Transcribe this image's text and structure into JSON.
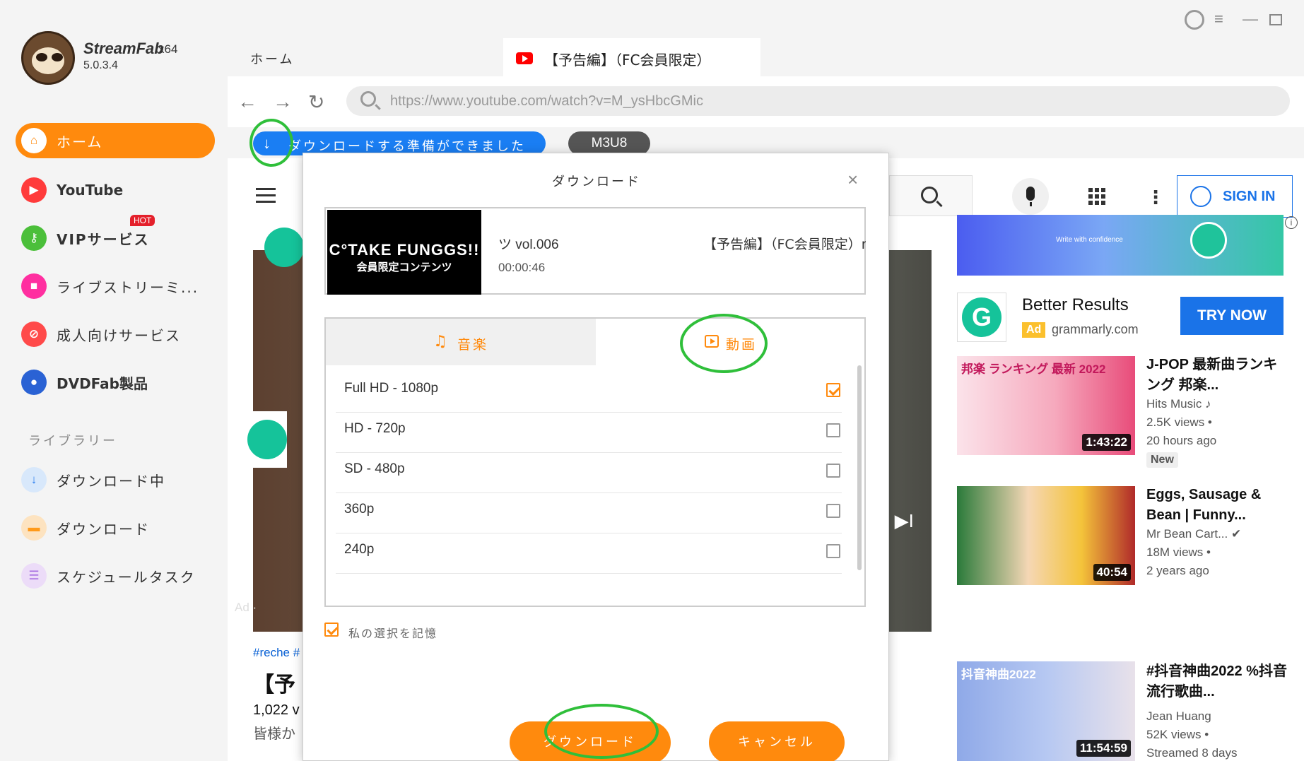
{
  "app": {
    "name": "StreamFab",
    "arch": "x64",
    "version": "5.0.3.4"
  },
  "sidebar": {
    "items": [
      {
        "label": "ホーム",
        "icon": "home-icon",
        "color": "#ff8a0d",
        "active": true
      },
      {
        "label": "YouTube",
        "icon": "youtube-icon",
        "color": "#ff3b3b",
        "active": false
      },
      {
        "label": "VIPサービス",
        "icon": "key-icon",
        "color": "#4bbf3a",
        "active": false,
        "badge": "HOT"
      },
      {
        "label": "ライブストリーミ...",
        "icon": "camera-icon",
        "color": "#ff2fa0",
        "active": false
      },
      {
        "label": "成人向けサービス",
        "icon": "adult-icon",
        "color": "#ff4a4a",
        "active": false
      },
      {
        "label": "DVDFab製品",
        "icon": "dvdfab-icon",
        "color": "#2a62d4",
        "active": false
      }
    ],
    "library_title": "ライブラリー",
    "library_items": [
      {
        "label": "ダウンロード中",
        "icon": "download-icon",
        "color": "#2a7ef0"
      },
      {
        "label": "ダウンロード",
        "icon": "folder-icon",
        "color": "#ff9a1a"
      },
      {
        "label": "スケジュールタスク",
        "icon": "calendar-icon",
        "color": "#a56be0"
      }
    ]
  },
  "tabs": {
    "home": "ホーム",
    "active": "【予告編】（FC会員限定）"
  },
  "browser": {
    "url": "https://www.youtube.com/watch?v=M_ysHbcGMic",
    "ready_text": "ダウンロードする準備ができました",
    "m3u8": "M3U8"
  },
  "youtube": {
    "sign_in": "SIGN IN",
    "hashtag": "#reche #",
    "title_partial": "【予",
    "views_partial": "1,022 v",
    "desc_partial": "皆様か",
    "ad_banner_text": "Write with confidence",
    "ad_info": "i",
    "ad_title": "Better Results",
    "ad_label": "Ad",
    "ad_domain": "grammarly.com",
    "ad_cta": "TRY NOW",
    "player_ad": "Ad ·",
    "player_text": "d ▶I",
    "related": [
      {
        "title": "J-POP 最新曲ランキング 邦楽...",
        "channel": "Hits Music ♪",
        "views": "2.5K views •",
        "age": "20 hours ago",
        "duration": "1:43:22",
        "badge": "New",
        "thumb_text": "邦楽 ランキング 最新 2022"
      },
      {
        "title": "Eggs, Sausage & Bean | Funny...",
        "channel": "Mr Bean Cart... ✔",
        "views": "18M views •",
        "age": "2 years ago",
        "duration": "40:54",
        "thumb_text": ""
      },
      {
        "title": "#抖音神曲2022 %抖音流行歌曲...",
        "channel": "Jean Huang",
        "views": "52K views •",
        "age": "Streamed 8 days",
        "duration": "11:54:59",
        "thumb_text": "抖音神曲2022"
      }
    ]
  },
  "dialog": {
    "title": "ダウンロード",
    "close": "×",
    "video_name_a": "ツ vol.006",
    "video_name_b": "【予告編】（FC会員限定）re",
    "duration": "00:00:46",
    "thumb_line1": "C°TAKE FUNGGS!!",
    "thumb_line2": "会員限定コンテンツ",
    "tab_music": "音楽",
    "tab_video": "動画",
    "resolutions": [
      {
        "label": "Full HD - 1080p",
        "checked": true
      },
      {
        "label": "HD - 720p",
        "checked": false
      },
      {
        "label": "SD - 480p",
        "checked": false
      },
      {
        "label": "360p",
        "checked": false
      },
      {
        "label": "240p",
        "checked": false
      }
    ],
    "remember": "私の選択を記憶",
    "download_btn": "ダウンロード",
    "cancel_btn": "キャンセル"
  }
}
